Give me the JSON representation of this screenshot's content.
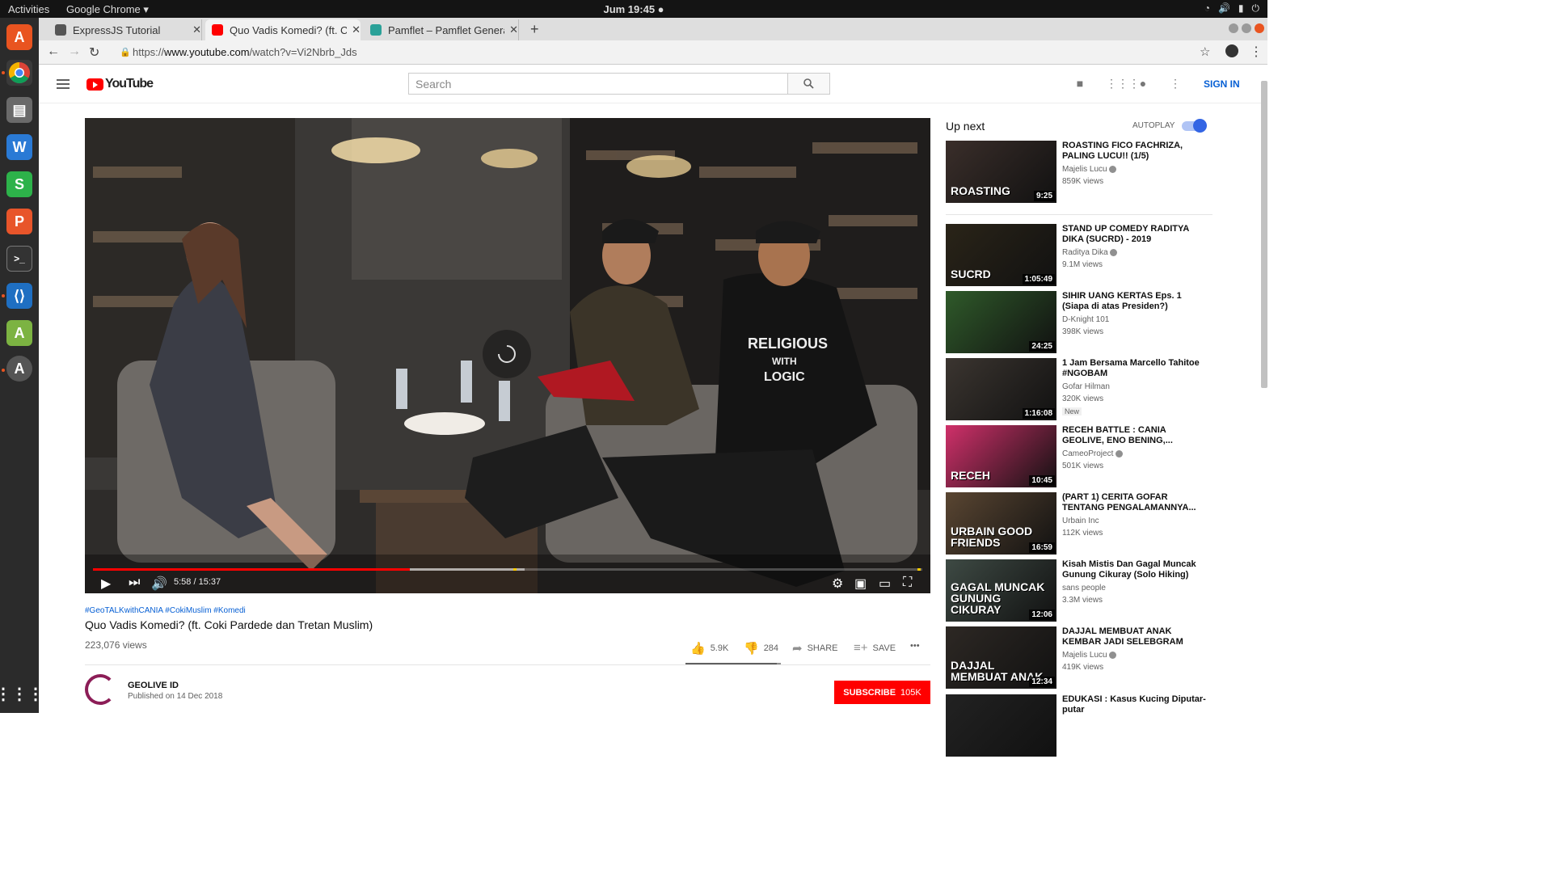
{
  "os": {
    "activities": "Activities",
    "app_menu": "Google Chrome ▾",
    "clock": "Jum 19:45 ●",
    "tray": [
      "wifi-icon",
      "volume-icon",
      "battery-icon",
      "power-icon"
    ]
  },
  "tabs": [
    {
      "title": "ExpressJS Tutorial",
      "favicon_color": "#555555"
    },
    {
      "title": "Quo Vadis Komedi? (ft. Coki",
      "favicon_color": "#ff0000"
    },
    {
      "title": "Pamflet – Pamflet Genera",
      "favicon_color": "#2aa198"
    }
  ],
  "newtab": "+",
  "address": {
    "scheme": "https://",
    "host": "www.youtube.com",
    "path": "/watch?v=Vi2Nbrb_Jds"
  },
  "youtube": {
    "logo": "YouTube",
    "search_placeholder": "Search",
    "sign_in": "SIGN IN"
  },
  "player": {
    "current": "5:58",
    "duration": "15:37",
    "time_text": "5:58 / 15:37",
    "progress_fraction": 0.382,
    "buffered_fraction": 0.52
  },
  "video": {
    "hashtags": "#GeoTALKwithCANIA #CokiMuslim #Komedi",
    "title": "Quo Vadis Komedi? (ft. Coki Pardede dan Tretan Muslim)",
    "views": "223,076 views",
    "likes": "5.9K",
    "dislikes": "284",
    "like_fraction": 0.954,
    "share": "SHARE",
    "save": "SAVE",
    "more": "•••"
  },
  "channel": {
    "name": "GEOLIVE ID",
    "published": "Published on 14 Dec 2018",
    "subscribe": "SUBSCRIBE",
    "subscribers": "105K"
  },
  "sidebar": {
    "up_next": "Up next",
    "autoplay": "AUTOPLAY"
  },
  "recommendations": [
    {
      "title": "ROASTING FICO FACHRIZA, PALING LUCU!! (1/5)",
      "channel": "Majelis Lucu",
      "verified": true,
      "views": "859K views",
      "duration": "9:25",
      "thumb_text": "ROASTING",
      "color": "#3a2e2a"
    },
    {
      "title": "STAND UP COMEDY RADITYA DIKA (SUCRD) - 2019",
      "channel": "Raditya Dika",
      "verified": true,
      "views": "9.1M views",
      "duration": "1:05:49",
      "thumb_text": "SUCRD",
      "color": "#2a2418"
    },
    {
      "title": "SIHIR UANG KERTAS Eps. 1 (Siapa di atas Presiden?)",
      "channel": "D-Knight 101",
      "verified": false,
      "views": "398K views",
      "duration": "24:25",
      "thumb_text": "",
      "color": "#2f5a2a"
    },
    {
      "title": "1 Jam Bersama Marcello Tahitoe #NGOBAM",
      "channel": "Gofar Hilman",
      "verified": false,
      "views": "320K views",
      "duration": "1:16:08",
      "badge": "New",
      "thumb_text": "",
      "color": "#3b3530"
    },
    {
      "title": "RECEH BATTLE : CANIA GEOLIVE, ENO BENING,...",
      "channel": "CameoProject",
      "verified": true,
      "views": "501K views",
      "duration": "10:45",
      "thumb_text": "RECEH",
      "color": "#d0306a"
    },
    {
      "title": "(PART 1) CERITA GOFAR TENTANG PENGALAMANNYA...",
      "channel": "Urbain Inc",
      "verified": false,
      "views": "112K views",
      "duration": "16:59",
      "thumb_text": "URBAIN GOOD FRIENDS",
      "color": "#5a4632"
    },
    {
      "title": "Kisah Mistis Dan Gagal Muncak Gunung Cikuray (Solo Hiking)",
      "channel": "sans people",
      "verified": false,
      "views": "3.3M views",
      "duration": "12:06",
      "thumb_text": "GAGAL MUNCAK GUNUNG CIKURAY",
      "color": "#3e4a44"
    },
    {
      "title": "DAJJAL MEMBUAT ANAK KEMBAR JADI SELEBGRAM",
      "channel": "Majelis Lucu",
      "verified": true,
      "views": "419K views",
      "duration": "12:34",
      "thumb_text": "DAJJAL MEMBUAT ANAK",
      "color": "#2d2824"
    },
    {
      "title": "EDUKASI : Kasus Kucing Diputar-putar",
      "channel": "",
      "verified": false,
      "views": "",
      "duration": "",
      "thumb_text": "",
      "color": "#222222"
    }
  ]
}
